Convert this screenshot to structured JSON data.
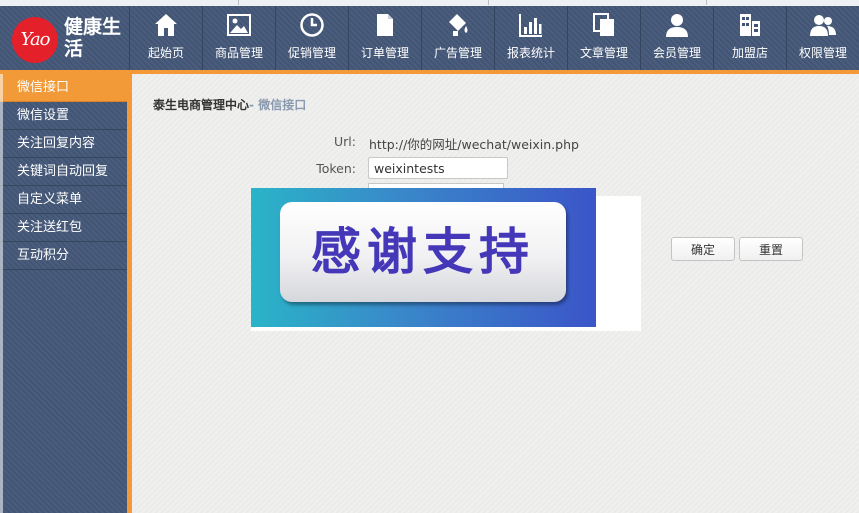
{
  "brand": {
    "logo_mark": "Yao",
    "name": "健康生活",
    "accent": "#f29a38",
    "logo_color": "#e4202b"
  },
  "topnav": [
    {
      "label": "起始页",
      "icon": "home-icon"
    },
    {
      "label": "商品管理",
      "icon": "image-icon"
    },
    {
      "label": "促销管理",
      "icon": "clock-icon"
    },
    {
      "label": "订单管理",
      "icon": "document-icon"
    },
    {
      "label": "广告管理",
      "icon": "paint-bucket-icon"
    },
    {
      "label": "报表统计",
      "icon": "bar-chart-icon"
    },
    {
      "label": "文章管理",
      "icon": "copy-icon"
    },
    {
      "label": "会员管理",
      "icon": "user-icon"
    },
    {
      "label": "加盟店",
      "icon": "building-icon"
    },
    {
      "label": "权限管理",
      "icon": "users-icon"
    }
  ],
  "sidebar": {
    "items": [
      {
        "label": "微信接口",
        "active": true
      },
      {
        "label": "微信设置"
      },
      {
        "label": "关注回复内容"
      },
      {
        "label": "关键词自动回复"
      },
      {
        "label": "自定义菜单"
      },
      {
        "label": "关注送红包"
      },
      {
        "label": "互动积分"
      }
    ]
  },
  "breadcrumb": {
    "root": "泰生电商管理中心",
    "separator": "- ",
    "current": "微信接口"
  },
  "form": {
    "url_label": "Url:",
    "url_value": "http://你的网址/wechat/weixin.php",
    "token_label": "Token:",
    "token_value": "weixintests",
    "confirm_label": "确定",
    "reset_label": "重置"
  },
  "overlay": {
    "text": "感谢支持"
  }
}
